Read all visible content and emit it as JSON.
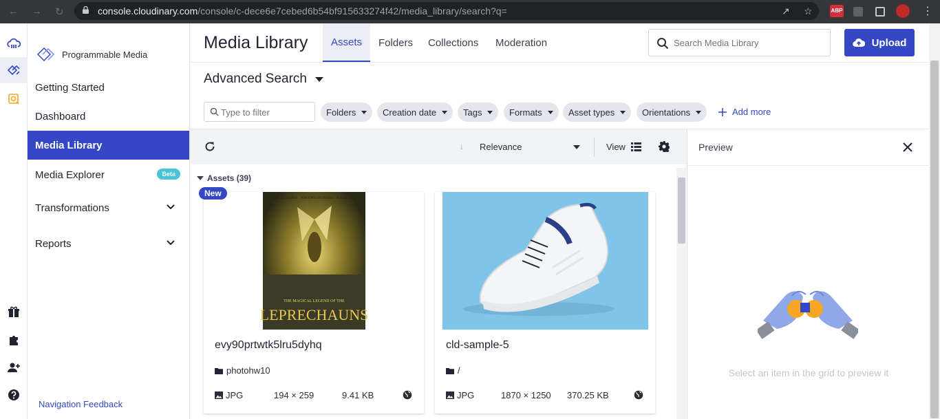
{
  "browser": {
    "url_domain": "console.cloudinary.com",
    "url_path": "/console/c-dece6e7cebed6b54bf915633274f42/media_library/search?q=",
    "extension_badge": "ABP"
  },
  "sidebar": {
    "product": "Programmable Media",
    "items": [
      {
        "label": "Getting Started"
      },
      {
        "label": "Dashboard"
      },
      {
        "label": "Media Library"
      },
      {
        "label": "Media Explorer",
        "badge": "Beta"
      },
      {
        "label": "Transformations"
      },
      {
        "label": "Reports"
      }
    ],
    "feedback": "Navigation Feedback"
  },
  "header": {
    "title": "Media Library",
    "tabs": [
      "Assets",
      "Folders",
      "Collections",
      "Moderation"
    ],
    "search_placeholder": "Search Media Library",
    "upload_label": "Upload"
  },
  "search": {
    "title": "Advanced Search",
    "filter_placeholder": "Type to filter",
    "chips": [
      "Folders",
      "Creation date",
      "Tags",
      "Formats",
      "Asset types",
      "Orientations"
    ],
    "add_more": "Add more"
  },
  "toolbar": {
    "sort": "Relevance",
    "view": "View"
  },
  "assets": {
    "header": "Assets (39)",
    "new_badge": "New",
    "items": [
      {
        "name": "evy90prtwtk5lru5dyhq",
        "folder": "photohw10",
        "format": "JPG",
        "dimensions": "194 × 259",
        "size": "9.41 KB",
        "poster_text": "LEPRECHAUNS",
        "poster_subtitle": "THE MAGICAL LEGEND OF THE",
        "poster_credits": [
          "RANDY QUAID",
          "WHOOPI GOLDBERG",
          "ROGER DALTREY"
        ]
      },
      {
        "name": "cld-sample-5",
        "folder": "/",
        "format": "JPG",
        "dimensions": "1870 × 1250",
        "size": "370.25 KB"
      }
    ]
  },
  "preview": {
    "title": "Preview",
    "message": "Select an item in the grid to preview it"
  },
  "colors": {
    "accent": "#3448c5",
    "chrome": "#35363a",
    "beta": "#48c4d8"
  }
}
